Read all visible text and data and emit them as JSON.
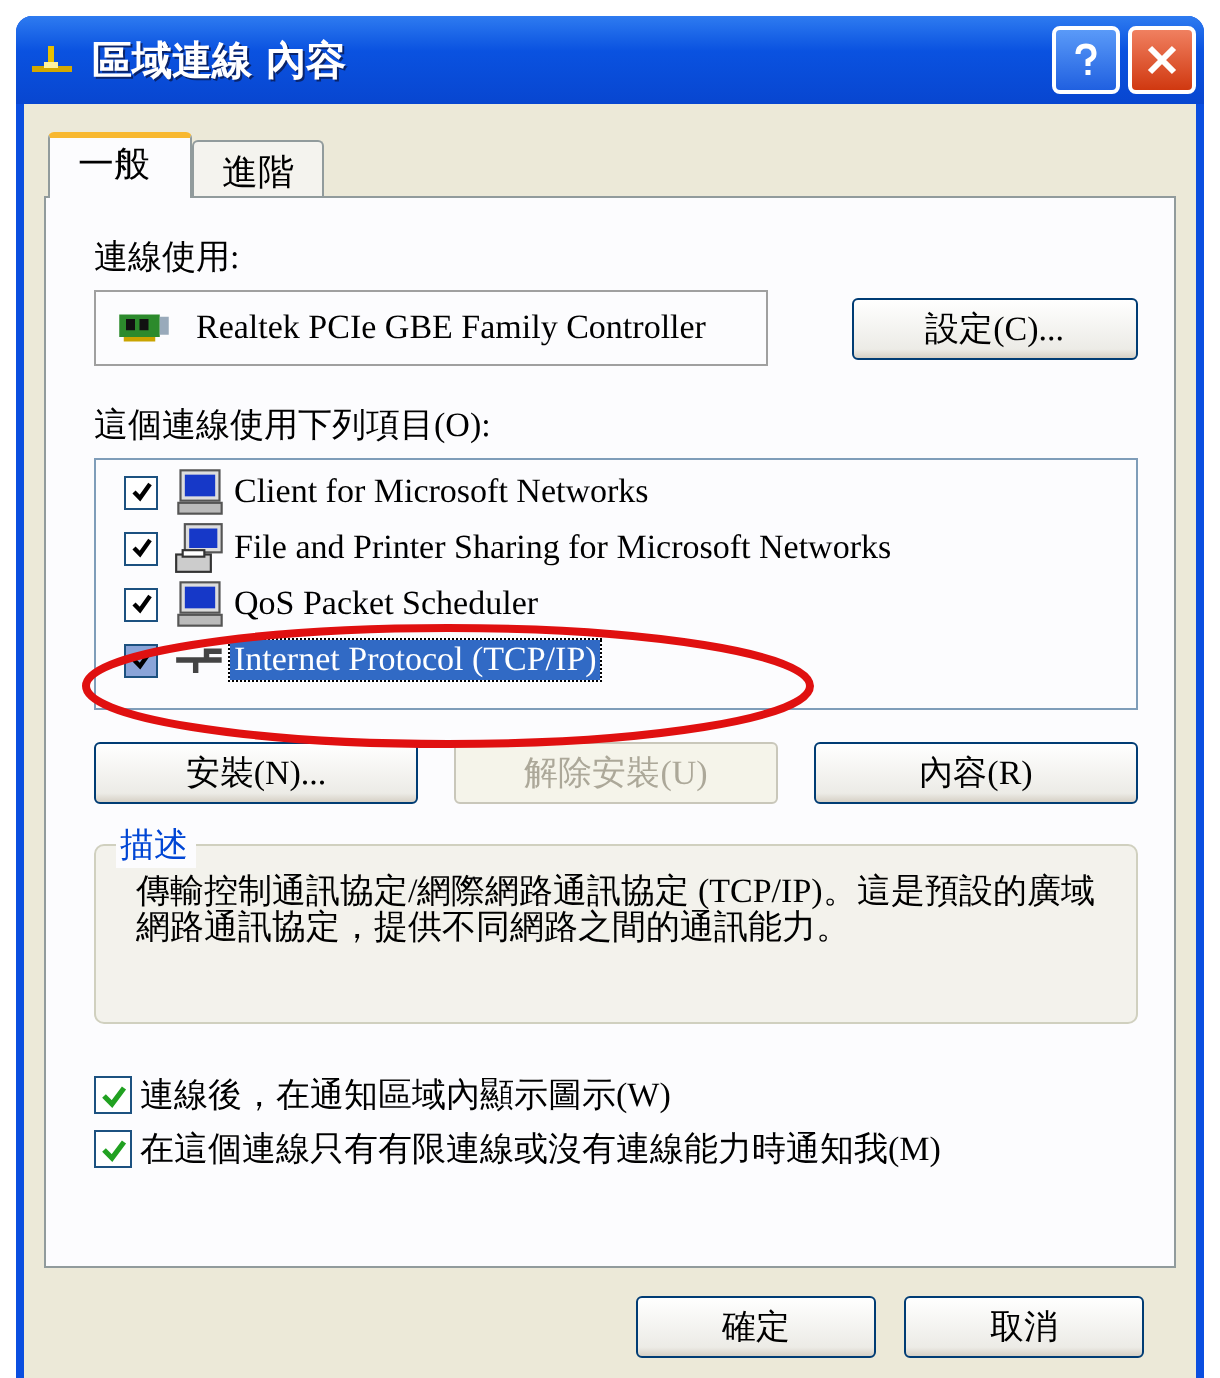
{
  "window": {
    "title": "區域連線 內容"
  },
  "tabs": [
    {
      "label": "一般",
      "selected": true
    },
    {
      "label": "進階",
      "selected": false
    }
  ],
  "connect_using": {
    "label": "連線使用:",
    "adapter": "Realtek PCIe GBE Family Controller",
    "configure_button": "設定(C)..."
  },
  "components": {
    "label": "這個連線使用下列項目(O):",
    "items": [
      {
        "name": "Client for Microsoft Networks",
        "kind": "client",
        "checked": true,
        "selected": false
      },
      {
        "name": "File and Printer Sharing for Microsoft Networks",
        "kind": "sharing",
        "checked": true,
        "selected": false
      },
      {
        "name": "QoS Packet Scheduler",
        "kind": "client",
        "checked": true,
        "selected": false
      },
      {
        "name": "Internet Protocol (TCP/IP)",
        "kind": "protocol",
        "checked": true,
        "selected": true
      }
    ]
  },
  "item_buttons": [
    {
      "label": "安裝(N)...",
      "disabled": false
    },
    {
      "label": "解除安裝(U)",
      "disabled": true
    },
    {
      "label": "內容(R)",
      "disabled": false
    }
  ],
  "description": {
    "legend": "描述",
    "text": "傳輸控制通訊協定/網際網路通訊協定 (TCP/IP)。這是預設的廣域網路通訊協定，提供不同網路之間的通訊能力。"
  },
  "options": [
    {
      "label": "連線後，在通知區域內顯示圖示(W)",
      "checked": true
    },
    {
      "label": "在這個連線只有有限連線或沒有連線能力時通知我(M)",
      "checked": true
    }
  ],
  "dialog_buttons": [
    "確定",
    "取消"
  ]
}
